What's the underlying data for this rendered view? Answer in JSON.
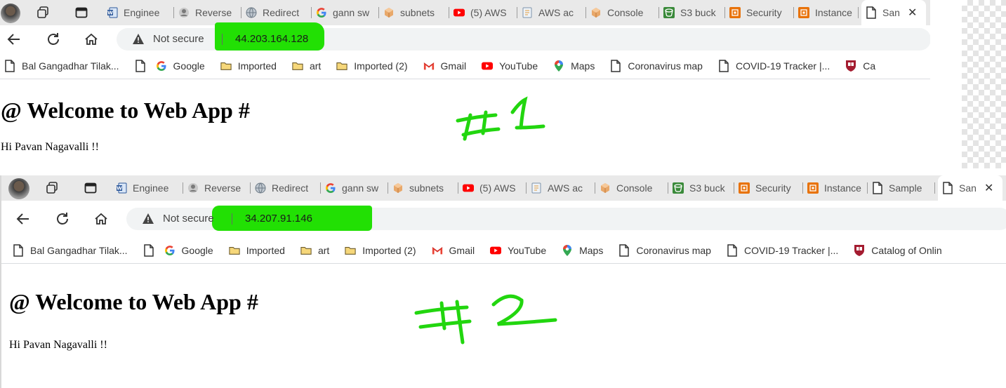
{
  "colors": {
    "highlight": "#22e004",
    "annotation": "#22d60f",
    "tabbar_bg": "#e9e9e9",
    "tab_text": "#555555"
  },
  "window1": {
    "tabs": [
      {
        "title": "Enginee",
        "icon": "word-doc-icon"
      },
      {
        "title": "Reverse",
        "icon": "user-circle-icon"
      },
      {
        "title": "Redirect",
        "icon": "globe-icon"
      },
      {
        "title": "gann sw",
        "icon": "google-icon"
      },
      {
        "title": "subnets",
        "icon": "aws-cube-icon"
      },
      {
        "title": "(5) AWS",
        "icon": "youtube-icon"
      },
      {
        "title": "AWS ac",
        "icon": "document-icon"
      },
      {
        "title": "Console",
        "icon": "aws-cube-icon"
      },
      {
        "title": "S3 buck",
        "icon": "s3-icon"
      },
      {
        "title": "Security",
        "icon": "ec2-icon"
      },
      {
        "title": "Instance",
        "icon": "ec2-icon"
      }
    ],
    "active_tab": {
      "title": "San",
      "icon": "page-icon"
    },
    "omnibox": {
      "security_label": "Not secure",
      "url": "44.203.164.128"
    },
    "bookmarks": [
      {
        "label": "Bal Gangadhar Tilak...",
        "icon": "page-icon"
      },
      {
        "label": "",
        "icon": "page-icon"
      },
      {
        "label": "Google",
        "icon": "google-icon"
      },
      {
        "label": "Imported",
        "icon": "folder-icon"
      },
      {
        "label": "art",
        "icon": "folder-icon"
      },
      {
        "label": "Imported (2)",
        "icon": "folder-icon"
      },
      {
        "label": "Gmail",
        "icon": "gmail-icon"
      },
      {
        "label": "YouTube",
        "icon": "youtube-icon"
      },
      {
        "label": "Maps",
        "icon": "maps-icon"
      },
      {
        "label": "Coronavirus map",
        "icon": "page-icon"
      },
      {
        "label": "COVID-19 Tracker |...",
        "icon": "page-icon"
      },
      {
        "label": "Ca",
        "icon": "harvard-icon"
      }
    ],
    "page": {
      "heading": "@ Welcome to Web App #",
      "text": "Hi Pavan Nagavalli !!"
    },
    "annotation": "#1"
  },
  "window2": {
    "tabs": [
      {
        "title": "Enginee",
        "icon": "word-doc-icon"
      },
      {
        "title": "Reverse",
        "icon": "user-circle-icon"
      },
      {
        "title": "Redirect",
        "icon": "globe-icon"
      },
      {
        "title": "gann sw",
        "icon": "google-icon"
      },
      {
        "title": "subnets",
        "icon": "aws-cube-icon"
      },
      {
        "title": "(5) AWS",
        "icon": "youtube-icon"
      },
      {
        "title": "AWS ac",
        "icon": "document-icon"
      },
      {
        "title": "Console",
        "icon": "aws-cube-icon"
      },
      {
        "title": "S3 buck",
        "icon": "s3-icon"
      },
      {
        "title": "Security",
        "icon": "ec2-icon"
      },
      {
        "title": "Instance",
        "icon": "ec2-icon"
      },
      {
        "title": "Sample",
        "icon": "page-icon"
      }
    ],
    "active_tab": {
      "title": "San",
      "icon": "page-icon"
    },
    "omnibox": {
      "security_label": "Not secure",
      "url": "34.207.91.146"
    },
    "bookmarks": [
      {
        "label": "Bal Gangadhar Tilak...",
        "icon": "page-icon"
      },
      {
        "label": "",
        "icon": "page-icon"
      },
      {
        "label": "Google",
        "icon": "google-icon"
      },
      {
        "label": "Imported",
        "icon": "folder-icon"
      },
      {
        "label": "art",
        "icon": "folder-icon"
      },
      {
        "label": "Imported (2)",
        "icon": "folder-icon"
      },
      {
        "label": "Gmail",
        "icon": "gmail-icon"
      },
      {
        "label": "YouTube",
        "icon": "youtube-icon"
      },
      {
        "label": "Maps",
        "icon": "maps-icon"
      },
      {
        "label": "Coronavirus map",
        "icon": "page-icon"
      },
      {
        "label": "COVID-19 Tracker |...",
        "icon": "page-icon"
      },
      {
        "label": "Catalog of Onlin",
        "icon": "harvard-icon"
      }
    ],
    "page": {
      "heading": "@ Welcome to Web App #",
      "text": "Hi Pavan Nagavalli !!"
    },
    "annotation": "#2"
  }
}
